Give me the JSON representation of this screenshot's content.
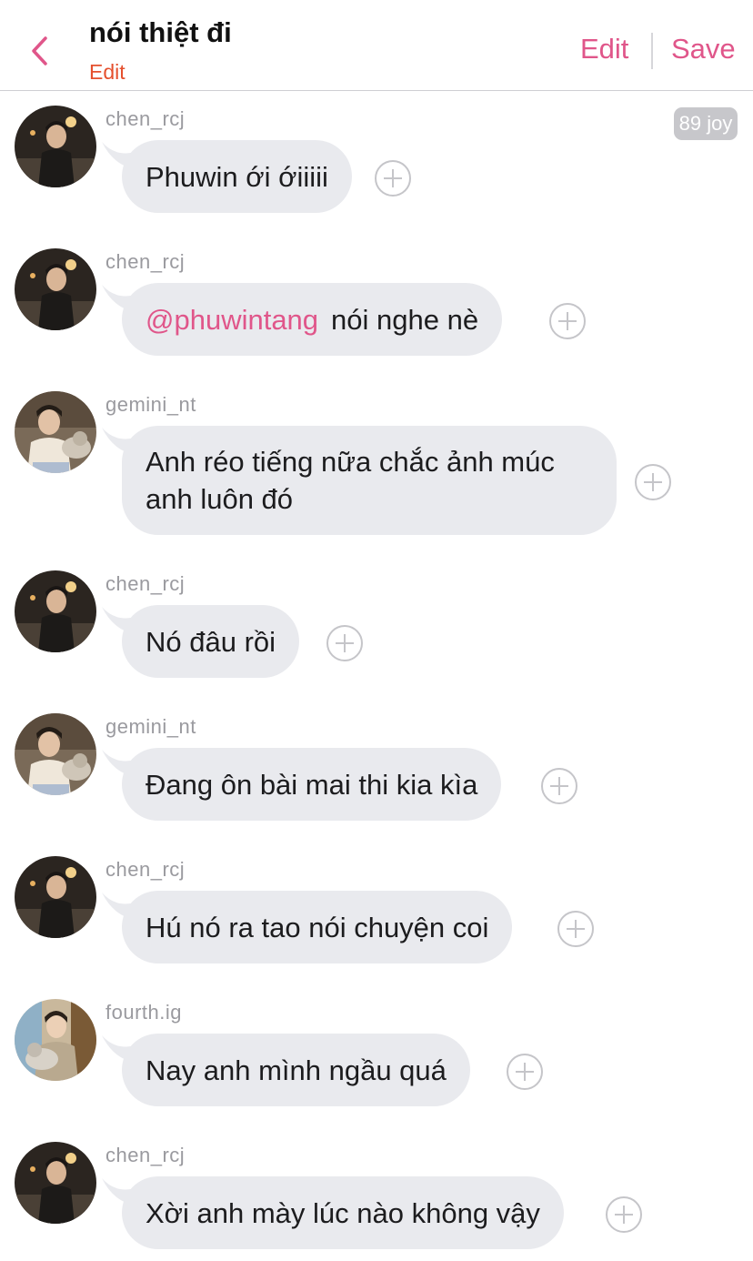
{
  "header": {
    "title": "nói thiệt đi",
    "subtitle": "Edit",
    "edit_label": "Edit",
    "save_label": "Save",
    "accent": "#e0568a"
  },
  "badge": {
    "text": "89 joy"
  },
  "messages": [
    {
      "user": "chen_rcj",
      "text": "Phuwin ới ớiiiii"
    },
    {
      "user": "chen_rcj",
      "mention": "@phuwintang",
      "text": "nói nghe nè"
    },
    {
      "user": "gemini_nt",
      "text": "Anh réo tiếng nữa chắc ảnh múc anh luôn đó"
    },
    {
      "user": "chen_rcj",
      "text": "Nó đâu rồi"
    },
    {
      "user": "gemini_nt",
      "text": "Đang ôn bài mai thi kia kìa"
    },
    {
      "user": "chen_rcj",
      "text": "Hú nó ra tao nói chuyện coi"
    },
    {
      "user": "fourth.ig",
      "text": "Nay anh mình ngầu quá"
    },
    {
      "user": "chen_rcj",
      "text": "Xời anh mày lúc nào không vậy"
    }
  ],
  "colors": {
    "bubble": "#e9eaee",
    "username": "#9a9a9f",
    "subtitle": "#e5502e"
  },
  "icons": [
    "back-chevron-icon",
    "add-reaction-icon",
    "avatar-chen-rcj",
    "avatar-gemini-nt",
    "avatar-fourth-ig"
  ]
}
